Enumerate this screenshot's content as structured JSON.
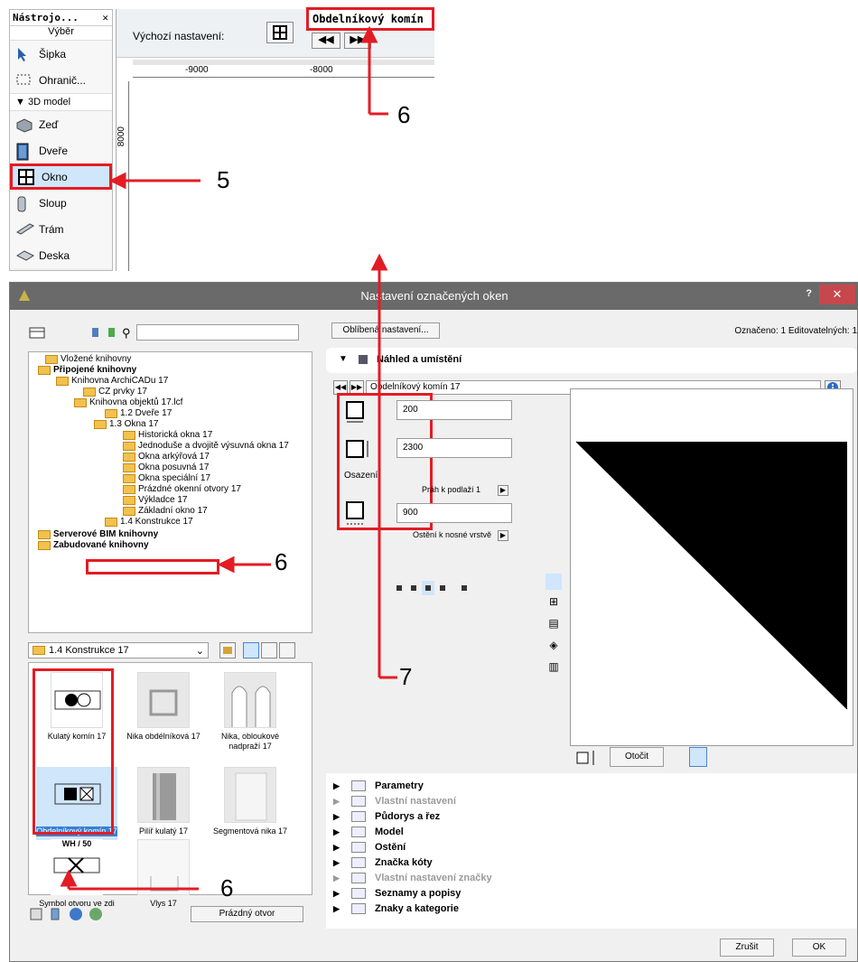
{
  "toolbox": {
    "title": "Nástrojo...",
    "close": "✕",
    "selection_label": "Výběr",
    "items": [
      {
        "label": "Šipka"
      },
      {
        "label": "Ohranič..."
      }
    ],
    "section": "3D model",
    "model_items": [
      {
        "label": "Zeď"
      },
      {
        "label": "Dveře"
      },
      {
        "label": "Okno"
      },
      {
        "label": "Sloup"
      },
      {
        "label": "Trám"
      },
      {
        "label": "Deska"
      }
    ]
  },
  "top_window": {
    "close": "✕",
    "default_label": "Výchozí nastavení:",
    "element_name": "Obdelníkový komín",
    "ruler_h": [
      "-9000",
      "-8000"
    ],
    "ruler_v": "8000"
  },
  "dialog": {
    "title": "Nastavení označených oken",
    "help": "?",
    "close": "✕",
    "favorites_button": "Oblíbená nastavení...",
    "selection_info": "Označeno: 1 Editovatelných: 1",
    "tree": [
      {
        "label": "Vložené knihovny",
        "bold": false
      },
      {
        "label": "Připojené knihovny",
        "bold": true
      },
      {
        "label": "Knihovna ArchiCADu 17",
        "bold": false
      },
      {
        "label": "CZ prvky 17",
        "bold": false
      },
      {
        "label": "Knihovna objektů 17.lcf",
        "bold": false
      },
      {
        "label": "1.2 Dveře 17",
        "bold": false
      },
      {
        "label": "1.3 Okna 17",
        "bold": false
      },
      {
        "label": "Historická okna 17",
        "bold": false
      },
      {
        "label": "Jednoduše a dvojitě výsuvná okna 17",
        "bold": false
      },
      {
        "label": "Okna arkýřová 17",
        "bold": false
      },
      {
        "label": "Okna posuvná 17",
        "bold": false
      },
      {
        "label": "Okna speciální 17",
        "bold": false
      },
      {
        "label": "Prázdné okenní otvory 17",
        "bold": false
      },
      {
        "label": "Výkladce 17",
        "bold": false
      },
      {
        "label": "Základní okno 17",
        "bold": false
      },
      {
        "label": "1.4 Konstrukce 17",
        "bold": false
      },
      {
        "label": "Serverové BIM knihovny",
        "bold": true
      },
      {
        "label": "Zabudované knihovny",
        "bold": true
      }
    ],
    "folder_select": "1.4 Konstrukce 17",
    "objects": [
      {
        "label": "Kulatý komín 17"
      },
      {
        "label": "Nika obdélníková 17"
      },
      {
        "label": "Nika, obloukové nadpraží 17"
      },
      {
        "label": "Obdelníkový komín 17"
      },
      {
        "label": "Pilíř kulatý 17"
      },
      {
        "label": "Segmentová nika 17"
      },
      {
        "label": "Symbol otvoru ve zdi 17"
      },
      {
        "label": "Vlys 17"
      }
    ],
    "symbol_text": "WH / 50",
    "empty_opening_button": "Prázdný otvor",
    "preview_section": "Náhled a umístění",
    "object_name_field": "Obdelníkový komín 17",
    "width": "200",
    "height": "2300",
    "anchor_label": "Osazení:",
    "sill_label": "Práh k podlaží 1",
    "sill_value": "900",
    "reveal_label": "Ostění k nosné vrstvě",
    "rotate_button": "Otočit",
    "properties": [
      {
        "label": "Parametry",
        "dim": false
      },
      {
        "label": "Vlastní nastavení",
        "dim": true
      },
      {
        "label": "Půdorys a řez",
        "dim": false
      },
      {
        "label": "Model",
        "dim": false
      },
      {
        "label": "Ostění",
        "dim": false
      },
      {
        "label": "Značka kóty",
        "dim": false
      },
      {
        "label": "Vlastní nastavení značky",
        "dim": true
      },
      {
        "label": "Seznamy a popisy",
        "dim": false
      },
      {
        "label": "Znaky a kategorie",
        "dim": false
      }
    ],
    "cancel_button": "Zrušit",
    "ok_button": "OK"
  },
  "callouts": {
    "five": "5",
    "six": "6",
    "seven": "7"
  },
  "colors": {
    "highlight": "#e31c24",
    "title_bar": "#6a6a6a",
    "close_button": "#c7484c"
  }
}
